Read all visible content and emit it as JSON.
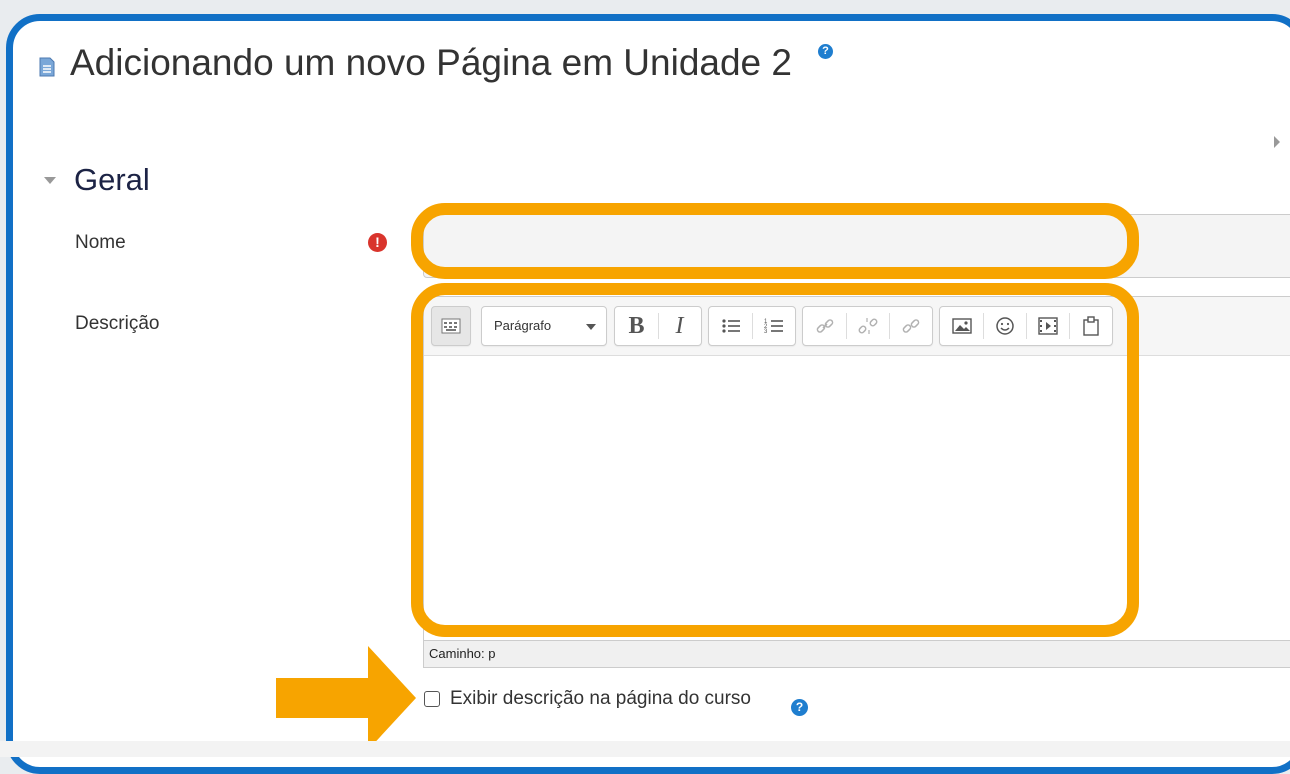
{
  "header": {
    "title": "Adicionando um novo Página em Unidade 2",
    "help_icon": "question-circle-icon",
    "page_icon": "page-icon"
  },
  "section": {
    "title": "Geral",
    "collapse_icon": "caret-down-icon"
  },
  "form": {
    "name_label": "Nome",
    "name_value": "",
    "name_required_icon": "required-exclamation-icon",
    "description_label": "Descrição",
    "description_value": "",
    "paragraph_select_value": "Parágrafo",
    "toolbar_buttons": [
      "Mostrar mais botões",
      "B",
      "I",
      "Lista não ordenada",
      "Lista ordenada",
      "Link",
      "Remover link",
      "Âncora",
      "Imagem",
      "Emoticon",
      "Mídia",
      "Gerenciar arquivos"
    ],
    "path_label": "Caminho: p",
    "show_description_label": "Exibir descrição na página do curso",
    "show_description_checked": false
  },
  "colors": {
    "frame_border": "#1170c6",
    "highlight": "#f7a400",
    "help_icon": "#1f7ecf",
    "required_icon": "#d9342c",
    "section_title": "#1c2345"
  }
}
